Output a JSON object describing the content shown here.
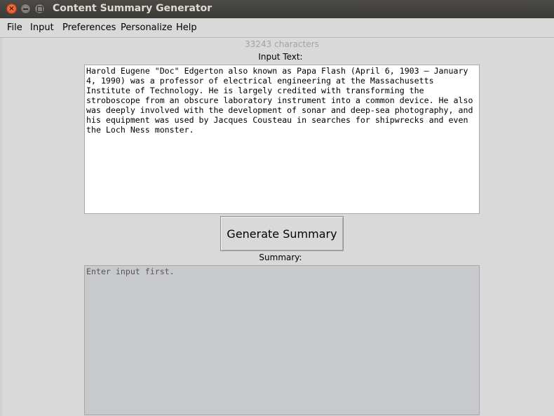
{
  "window": {
    "title": "Content Summary Generator",
    "controls": {
      "close_icon": "close-icon",
      "minimize_icon": "minimize-icon",
      "maximize_icon": "maximize-icon"
    }
  },
  "menubar": {
    "items": [
      {
        "label": "File"
      },
      {
        "label": "Input"
      },
      {
        "label": "Preferences"
      },
      {
        "label": "Personalize"
      },
      {
        "label": "Help"
      }
    ]
  },
  "main": {
    "char_count": "33243 characters",
    "input_label": "Input Text:",
    "input_text": "Harold Eugene \"Doc\" Edgerton also known as Papa Flash (April 6, 1903 – January\n4, 1990) was a professor of electrical engineering at the Massachusetts\nInstitute of Technology. He is largely credited with transforming the\nstroboscope from an obscure laboratory instrument into a common device. He also\nwas deeply involved with the development of sonar and deep-sea photography, and\nhis equipment was used by Jacques Cousteau in searches for shipwrecks and even\nthe Loch Ness monster.",
    "generate_button": "Generate Summary",
    "summary_label": "Summary:",
    "summary_text": "Enter input first."
  },
  "colors": {
    "titlebar": "#3c3b37",
    "window_bg": "#d9d9d9",
    "summary_bg": "#c8c9cc",
    "close_button": "#e0532a"
  }
}
